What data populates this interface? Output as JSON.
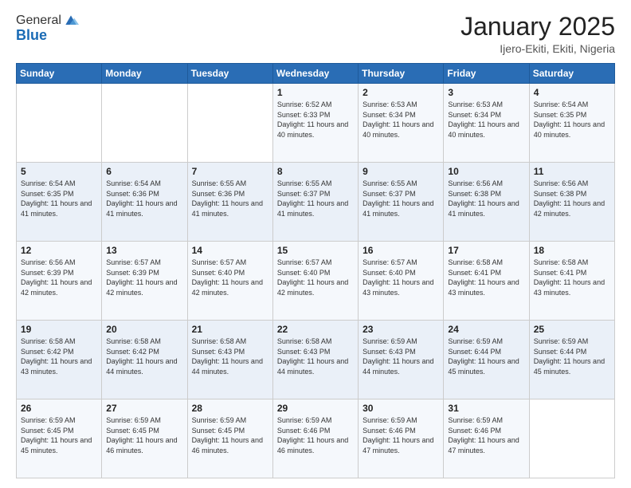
{
  "logo": {
    "general": "General",
    "blue": "Blue"
  },
  "header": {
    "month": "January 2025",
    "location": "Ijero-Ekiti, Ekiti, Nigeria"
  },
  "days_of_week": [
    "Sunday",
    "Monday",
    "Tuesday",
    "Wednesday",
    "Thursday",
    "Friday",
    "Saturday"
  ],
  "weeks": [
    [
      {
        "day": "",
        "info": ""
      },
      {
        "day": "",
        "info": ""
      },
      {
        "day": "",
        "info": ""
      },
      {
        "day": "1",
        "info": "Sunrise: 6:52 AM\nSunset: 6:33 PM\nDaylight: 11 hours and 40 minutes."
      },
      {
        "day": "2",
        "info": "Sunrise: 6:53 AM\nSunset: 6:34 PM\nDaylight: 11 hours and 40 minutes."
      },
      {
        "day": "3",
        "info": "Sunrise: 6:53 AM\nSunset: 6:34 PM\nDaylight: 11 hours and 40 minutes."
      },
      {
        "day": "4",
        "info": "Sunrise: 6:54 AM\nSunset: 6:35 PM\nDaylight: 11 hours and 40 minutes."
      }
    ],
    [
      {
        "day": "5",
        "info": "Sunrise: 6:54 AM\nSunset: 6:35 PM\nDaylight: 11 hours and 41 minutes."
      },
      {
        "day": "6",
        "info": "Sunrise: 6:54 AM\nSunset: 6:36 PM\nDaylight: 11 hours and 41 minutes."
      },
      {
        "day": "7",
        "info": "Sunrise: 6:55 AM\nSunset: 6:36 PM\nDaylight: 11 hours and 41 minutes."
      },
      {
        "day": "8",
        "info": "Sunrise: 6:55 AM\nSunset: 6:37 PM\nDaylight: 11 hours and 41 minutes."
      },
      {
        "day": "9",
        "info": "Sunrise: 6:55 AM\nSunset: 6:37 PM\nDaylight: 11 hours and 41 minutes."
      },
      {
        "day": "10",
        "info": "Sunrise: 6:56 AM\nSunset: 6:38 PM\nDaylight: 11 hours and 41 minutes."
      },
      {
        "day": "11",
        "info": "Sunrise: 6:56 AM\nSunset: 6:38 PM\nDaylight: 11 hours and 42 minutes."
      }
    ],
    [
      {
        "day": "12",
        "info": "Sunrise: 6:56 AM\nSunset: 6:39 PM\nDaylight: 11 hours and 42 minutes."
      },
      {
        "day": "13",
        "info": "Sunrise: 6:57 AM\nSunset: 6:39 PM\nDaylight: 11 hours and 42 minutes."
      },
      {
        "day": "14",
        "info": "Sunrise: 6:57 AM\nSunset: 6:40 PM\nDaylight: 11 hours and 42 minutes."
      },
      {
        "day": "15",
        "info": "Sunrise: 6:57 AM\nSunset: 6:40 PM\nDaylight: 11 hours and 42 minutes."
      },
      {
        "day": "16",
        "info": "Sunrise: 6:57 AM\nSunset: 6:40 PM\nDaylight: 11 hours and 43 minutes."
      },
      {
        "day": "17",
        "info": "Sunrise: 6:58 AM\nSunset: 6:41 PM\nDaylight: 11 hours and 43 minutes."
      },
      {
        "day": "18",
        "info": "Sunrise: 6:58 AM\nSunset: 6:41 PM\nDaylight: 11 hours and 43 minutes."
      }
    ],
    [
      {
        "day": "19",
        "info": "Sunrise: 6:58 AM\nSunset: 6:42 PM\nDaylight: 11 hours and 43 minutes."
      },
      {
        "day": "20",
        "info": "Sunrise: 6:58 AM\nSunset: 6:42 PM\nDaylight: 11 hours and 44 minutes."
      },
      {
        "day": "21",
        "info": "Sunrise: 6:58 AM\nSunset: 6:43 PM\nDaylight: 11 hours and 44 minutes."
      },
      {
        "day": "22",
        "info": "Sunrise: 6:58 AM\nSunset: 6:43 PM\nDaylight: 11 hours and 44 minutes."
      },
      {
        "day": "23",
        "info": "Sunrise: 6:59 AM\nSunset: 6:43 PM\nDaylight: 11 hours and 44 minutes."
      },
      {
        "day": "24",
        "info": "Sunrise: 6:59 AM\nSunset: 6:44 PM\nDaylight: 11 hours and 45 minutes."
      },
      {
        "day": "25",
        "info": "Sunrise: 6:59 AM\nSunset: 6:44 PM\nDaylight: 11 hours and 45 minutes."
      }
    ],
    [
      {
        "day": "26",
        "info": "Sunrise: 6:59 AM\nSunset: 6:45 PM\nDaylight: 11 hours and 45 minutes."
      },
      {
        "day": "27",
        "info": "Sunrise: 6:59 AM\nSunset: 6:45 PM\nDaylight: 11 hours and 46 minutes."
      },
      {
        "day": "28",
        "info": "Sunrise: 6:59 AM\nSunset: 6:45 PM\nDaylight: 11 hours and 46 minutes."
      },
      {
        "day": "29",
        "info": "Sunrise: 6:59 AM\nSunset: 6:46 PM\nDaylight: 11 hours and 46 minutes."
      },
      {
        "day": "30",
        "info": "Sunrise: 6:59 AM\nSunset: 6:46 PM\nDaylight: 11 hours and 47 minutes."
      },
      {
        "day": "31",
        "info": "Sunrise: 6:59 AM\nSunset: 6:46 PM\nDaylight: 11 hours and 47 minutes."
      },
      {
        "day": "",
        "info": ""
      }
    ]
  ]
}
